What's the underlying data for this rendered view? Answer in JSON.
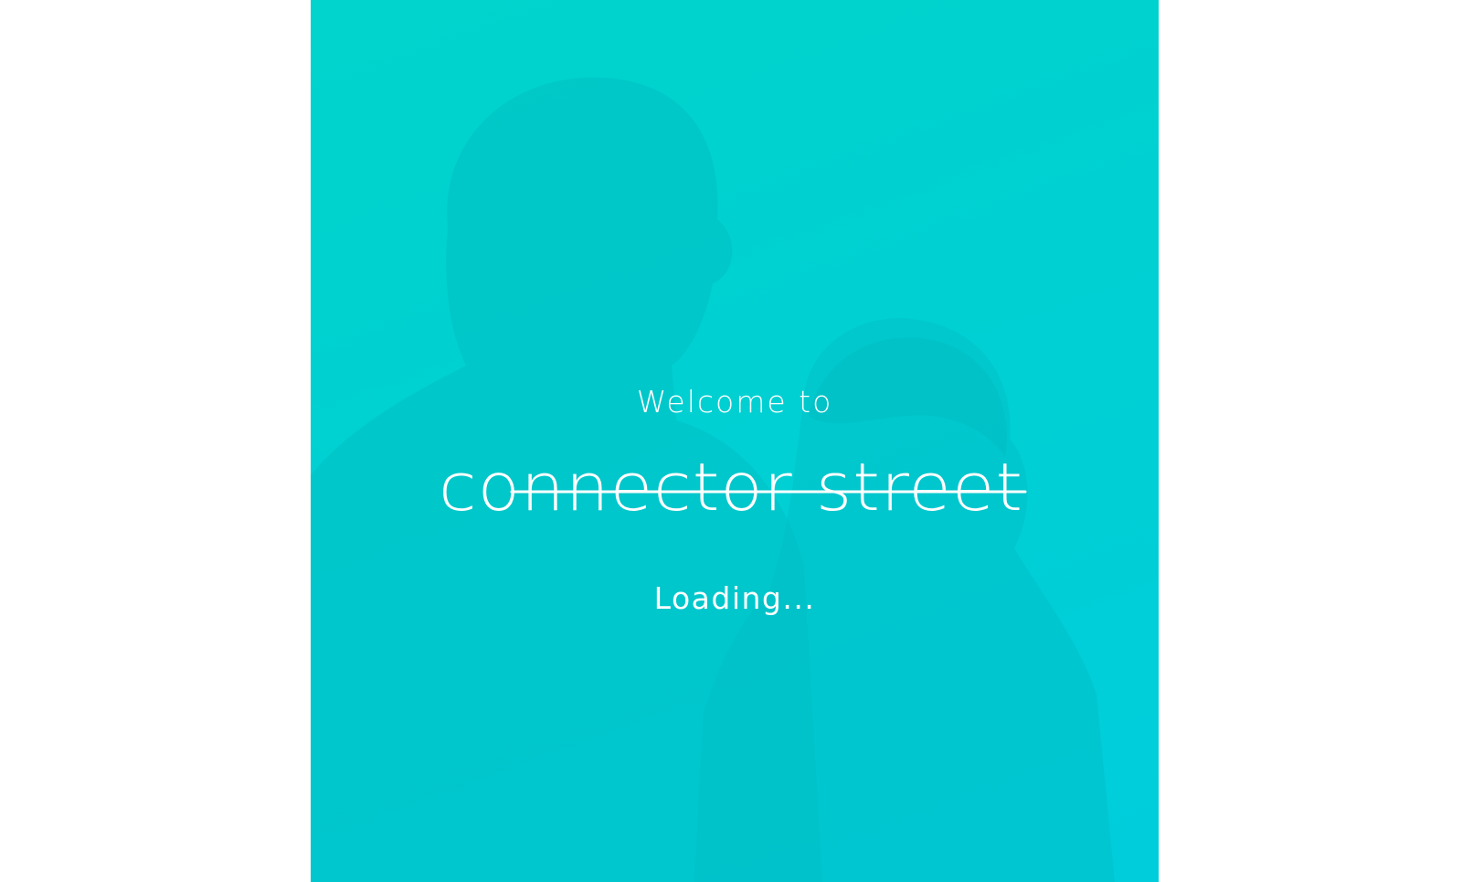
{
  "splash": {
    "welcome_text": "Welcome to",
    "brand_name": "connector street",
    "loading_text": "Loading..."
  },
  "colors": {
    "background": "#ffffff",
    "splash_gradient_start": "#00d4cc",
    "splash_gradient_end": "#00cddc",
    "foreground_text": "#ffffff"
  }
}
